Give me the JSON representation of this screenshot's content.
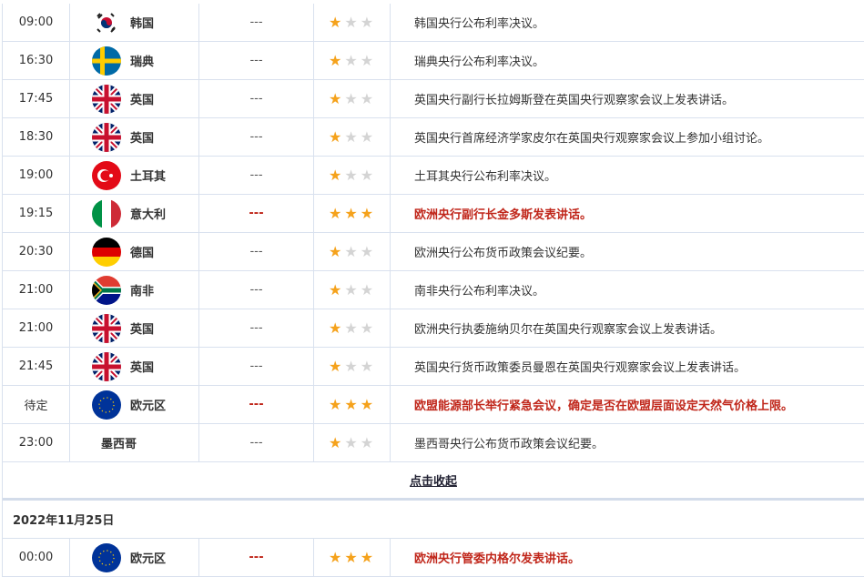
{
  "rows": [
    {
      "time": "09:00",
      "country": "韩国",
      "flag": "kr",
      "value": "---",
      "stars": 1,
      "desc": "韩国央行公布利率决议。",
      "hi": false
    },
    {
      "time": "16:30",
      "country": "瑞典",
      "flag": "se",
      "value": "---",
      "stars": 1,
      "desc": "瑞典央行公布利率决议。",
      "hi": false
    },
    {
      "time": "17:45",
      "country": "英国",
      "flag": "gb",
      "value": "---",
      "stars": 1,
      "desc": "英国央行副行长拉姆斯登在英国央行观察家会议上发表讲话。",
      "hi": false
    },
    {
      "time": "18:30",
      "country": "英国",
      "flag": "gb",
      "value": "---",
      "stars": 1,
      "desc": "英国央行首席经济学家皮尔在英国央行观察家会议上参加小组讨论。",
      "hi": false
    },
    {
      "time": "19:00",
      "country": "土耳其",
      "flag": "tr",
      "value": "---",
      "stars": 1,
      "desc": "土耳其央行公布利率决议。",
      "hi": false
    },
    {
      "time": "19:15",
      "country": "意大利",
      "flag": "it",
      "value": "---",
      "stars": 3,
      "desc": "欧洲央行副行长金多斯发表讲话。",
      "hi": true
    },
    {
      "time": "20:30",
      "country": "德国",
      "flag": "de",
      "value": "---",
      "stars": 1,
      "desc": "欧洲央行公布货币政策会议纪要。",
      "hi": false
    },
    {
      "time": "21:00",
      "country": "南非",
      "flag": "za",
      "value": "---",
      "stars": 1,
      "desc": "南非央行公布利率决议。",
      "hi": false
    },
    {
      "time": "21:00",
      "country": "英国",
      "flag": "gb",
      "value": "---",
      "stars": 1,
      "desc": "欧洲央行执委施纳贝尔在英国央行观察家会议上发表讲话。",
      "hi": false
    },
    {
      "time": "21:45",
      "country": "英国",
      "flag": "gb",
      "value": "---",
      "stars": 1,
      "desc": "英国央行货币政策委员曼恩在英国央行观察家会议上发表讲话。",
      "hi": false
    },
    {
      "time": "待定",
      "country": "欧元区",
      "flag": "eu",
      "value": "---",
      "stars": 3,
      "desc": "欧盟能源部长举行紧急会议，确定是否在欧盟层面设定天然气价格上限。",
      "hi": true
    },
    {
      "time": "23:00",
      "country": "墨西哥",
      "flag": "none",
      "value": "---",
      "stars": 1,
      "desc": "墨西哥央行公布货币政策会议纪要。",
      "hi": false
    }
  ],
  "collapse_label": "点击收起",
  "date_header": "2022年11月25日",
  "next_rows": [
    {
      "time": "00:00",
      "country": "欧元区",
      "flag": "eu",
      "value": "---",
      "stars": 3,
      "desc": "欧洲央行管委内格尔发表讲话。",
      "hi": true
    }
  ],
  "colors": {
    "star_on": "#f5a21c",
    "star_off": "#d4d4d4",
    "highlight": "#c0261a"
  }
}
